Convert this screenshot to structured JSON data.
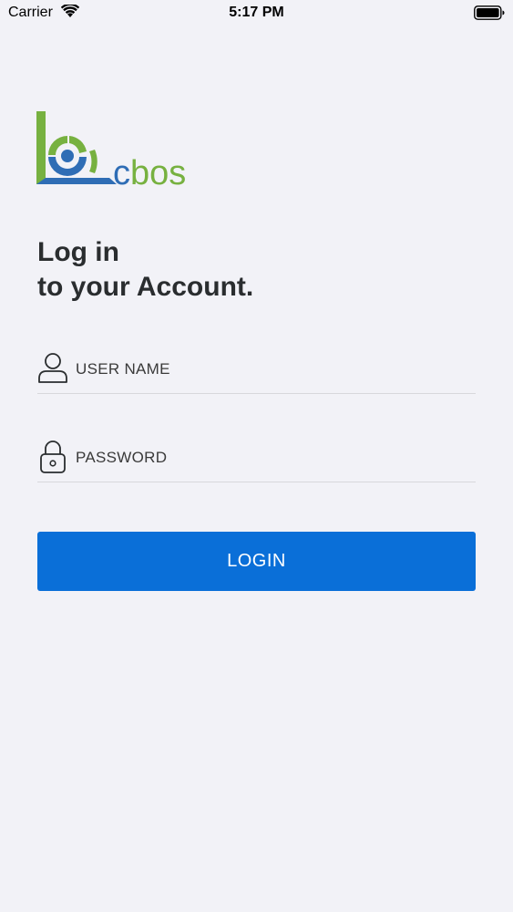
{
  "status_bar": {
    "carrier": "Carrier",
    "time": "5:17 PM",
    "icons": [
      "wifi-icon",
      "battery-icon"
    ]
  },
  "logo": {
    "text": "cbos",
    "colors": {
      "green": "#77b140",
      "blue": "#2f6db5"
    }
  },
  "headline": {
    "line1": "Log in",
    "line2": "to your Account."
  },
  "form": {
    "username": {
      "placeholder": "USER NAME",
      "value": "",
      "icon": "user-icon"
    },
    "password": {
      "placeholder": "PASSWORD",
      "value": "",
      "icon": "lock-icon"
    }
  },
  "login_button": {
    "label": "LOGIN",
    "color": "#0a6fd8"
  },
  "theme": {
    "background": "#f2f2f7",
    "text": "#2a2d2f",
    "divider": "#d8d8dc"
  }
}
